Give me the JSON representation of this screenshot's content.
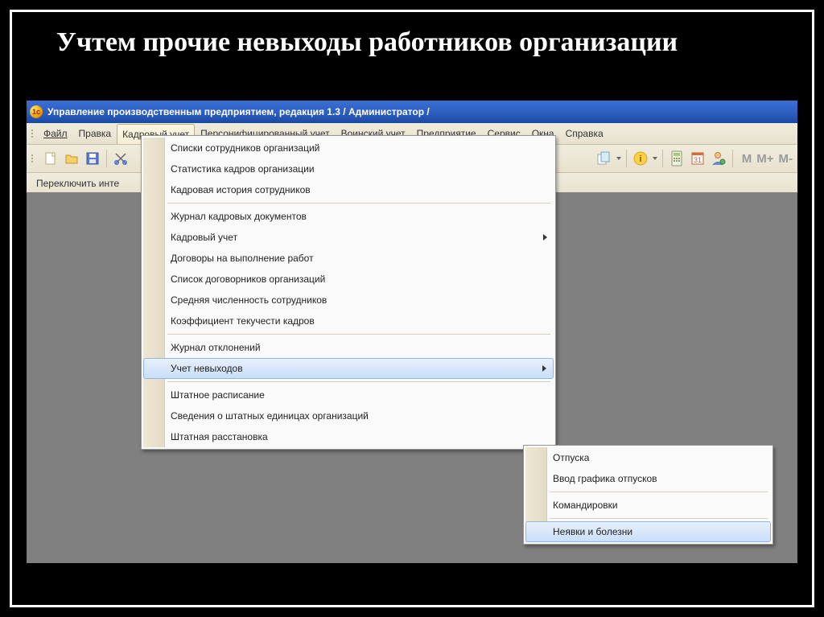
{
  "slide_title": "Учтем прочие невыходы работников организации",
  "titlebar": {
    "text": "Управление производственным предприятием, редакция 1.3 / Администратор /"
  },
  "menu": {
    "file": "Файл",
    "edit": "Правка",
    "kadr": "Кадровый учет",
    "pers": "Персонифицированный учет",
    "voin": "Воинский учет",
    "pred": "Предприятие",
    "serv": "Сервис",
    "okna": "Окна",
    "help": "Справка"
  },
  "secondbar": {
    "switch": "Переключить инте"
  },
  "dropdown": {
    "items": [
      "Списки сотрудников организаций",
      "Статистика кадров организации",
      "Кадровая история сотрудников",
      "Журнал кадровых документов",
      "Кадровый учет",
      "Договоры на выполнение работ",
      "Список договорников организаций",
      "Средняя численность сотрудников",
      "Коэффициент текучести кадров",
      "Журнал отклонений",
      "Учет невыходов",
      "Штатное расписание",
      "Сведения о штатных единицах организаций",
      "Штатная расстановка"
    ]
  },
  "submenu": {
    "items": [
      "Отпуска",
      "Ввод графика отпусков",
      "Командировки",
      "Неявки и болезни"
    ]
  },
  "m_labels": {
    "m": "M",
    "mplus": "M+",
    "mminus": "M-"
  }
}
